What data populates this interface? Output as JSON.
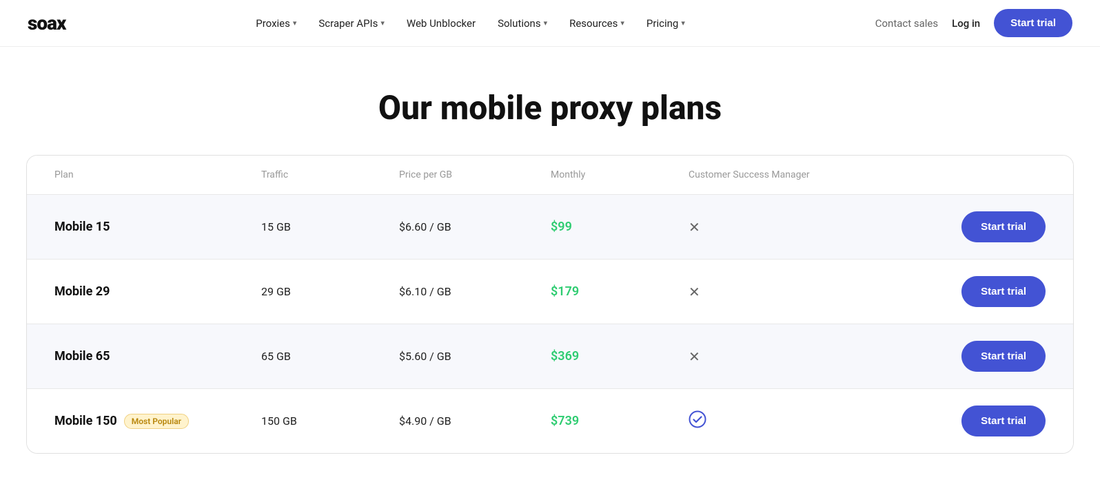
{
  "logo": "soax",
  "nav": {
    "items": [
      {
        "label": "Proxies",
        "hasDropdown": true
      },
      {
        "label": "Scraper APIs",
        "hasDropdown": true
      },
      {
        "label": "Web Unblocker",
        "hasDropdown": false
      },
      {
        "label": "Solutions",
        "hasDropdown": true
      },
      {
        "label": "Resources",
        "hasDropdown": true
      },
      {
        "label": "Pricing",
        "hasDropdown": true
      }
    ],
    "contact_label": "Contact sales",
    "login_label": "Log in",
    "cta_label": "Start trial"
  },
  "page": {
    "title": "Our mobile proxy plans"
  },
  "table": {
    "headers": [
      "Plan",
      "Traffic",
      "Price per GB",
      "Monthly",
      "Customer Success Manager",
      ""
    ],
    "rows": [
      {
        "plan": "Mobile 15",
        "badge": null,
        "traffic": "15 GB",
        "price_per_gb": "$6.60 / GB",
        "monthly": "$99",
        "csm": false,
        "cta": "Start trial"
      },
      {
        "plan": "Mobile 29",
        "badge": null,
        "traffic": "29 GB",
        "price_per_gb": "$6.10 / GB",
        "monthly": "$179",
        "csm": false,
        "cta": "Start trial"
      },
      {
        "plan": "Mobile 65",
        "badge": null,
        "traffic": "65 GB",
        "price_per_gb": "$5.60 / GB",
        "monthly": "$369",
        "csm": false,
        "cta": "Start trial"
      },
      {
        "plan": "Mobile 150",
        "badge": "Most Popular",
        "traffic": "150 GB",
        "price_per_gb": "$4.90 / GB",
        "monthly": "$739",
        "csm": true,
        "cta": "Start trial"
      }
    ]
  }
}
